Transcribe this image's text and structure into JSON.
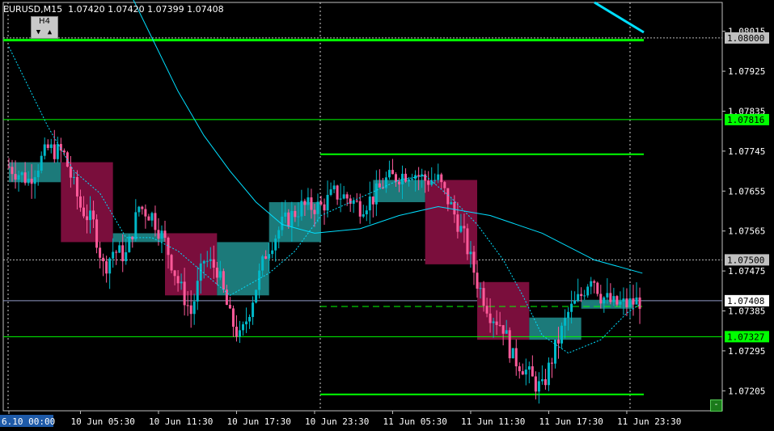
{
  "header": {
    "title": "EURUSD,M15  1.07420 1.07420 1.07399 1.07408",
    "timeframe_badge": "H4",
    "tf_down": "▼",
    "tf_up": "▲"
  },
  "corner_button": "-",
  "chart_data": {
    "type": "candlestick",
    "symbol": "EURUSD",
    "timeframe": "M15",
    "ohlc_header": [
      1.0742,
      1.0742,
      1.07399,
      1.07408
    ],
    "ylim": [
      1.0716,
      1.0808
    ],
    "price_ticks": [
      "1.08015",
      "1.07925",
      "1.07835",
      "1.07745",
      "1.07655",
      "1.07565",
      "1.07475",
      "1.07385",
      "1.07295",
      "1.07205"
    ],
    "price_tick_values": [
      1.08015,
      1.07925,
      1.07835,
      1.07745,
      1.07655,
      1.07565,
      1.07475,
      1.07385,
      1.07295,
      1.07205
    ],
    "time_ticks": [
      "6.10 00:00",
      "10 Jun 05:30",
      "10 Jun 11:30",
      "10 Jun 17:30",
      "10 Jun 23:30",
      "11 Jun 05:30",
      "11 Jun 11:30",
      "11 Jun 17:30",
      "11 Jun 23:30"
    ],
    "price_labels": [
      {
        "text": "1.08000",
        "value": 1.08,
        "style": "gray"
      },
      {
        "text": "1.07816",
        "value": 1.07816,
        "style": "green"
      },
      {
        "text": "1.07500",
        "value": 1.075,
        "style": "gray"
      },
      {
        "text": "1.07408",
        "value": 1.07408,
        "style": "white"
      },
      {
        "text": "1.07327",
        "value": 1.07327,
        "style": "green"
      }
    ],
    "h4_boxes": [
      {
        "t0": "10 Jun 00:00",
        "t1": "10 Jun 04:00",
        "open": 1.0772,
        "close": 1.07675,
        "direction": "up"
      },
      {
        "t0": "10 Jun 04:00",
        "t1": "10 Jun 08:00",
        "open": 1.0772,
        "close": 1.0754,
        "direction": "down"
      },
      {
        "t0": "10 Jun 08:00",
        "t1": "10 Jun 12:00",
        "open": 1.0754,
        "close": 1.0756,
        "direction": "up"
      },
      {
        "t0": "10 Jun 12:00",
        "t1": "10 Jun 16:00",
        "open": 1.0756,
        "close": 1.0742,
        "direction": "down"
      },
      {
        "t0": "10 Jun 16:00",
        "t1": "10 Jun 20:00",
        "open": 1.0742,
        "close": 1.0754,
        "direction": "up"
      },
      {
        "t0": "10 Jun 20:00",
        "t1": "11 Jun 00:00",
        "open": 1.0754,
        "close": 1.0763,
        "direction": "up"
      },
      {
        "t0": "11 Jun 04:00",
        "t1": "11 Jun 08:00",
        "open": 1.0763,
        "close": 1.0768,
        "direction": "up"
      },
      {
        "t0": "11 Jun 08:00",
        "t1": "11 Jun 12:00",
        "open": 1.0768,
        "close": 1.0749,
        "direction": "down"
      },
      {
        "t0": "11 Jun 12:00",
        "t1": "11 Jun 16:00",
        "open": 1.0745,
        "close": 1.0732,
        "direction": "down"
      },
      {
        "t0": "11 Jun 16:00",
        "t1": "11 Jun 20:00",
        "open": 1.0732,
        "close": 1.0737,
        "direction": "up"
      },
      {
        "t0": "11 Jun 20:00",
        "t1": "12 Jun 00:00",
        "open": 1.0739,
        "close": 1.0741,
        "direction": "up"
      }
    ],
    "levels": [
      {
        "value": 1.07995,
        "color": "#00ff00",
        "kind": "thick-line"
      },
      {
        "value": 1.07816,
        "color": "#00ff00",
        "kind": "thin-line"
      },
      {
        "value": 1.07738,
        "color": "#00ff00",
        "kind": "segment",
        "from": "10 Jun 23:30"
      },
      {
        "value": 1.07395,
        "color": "#00ff00",
        "kind": "dashed-segment",
        "from": "10 Jun 23:30"
      },
      {
        "value": 1.07327,
        "color": "#00ff00",
        "kind": "thin-line"
      },
      {
        "value": 1.07197,
        "color": "#00ff00",
        "kind": "segment",
        "from": "10 Jun 23:30"
      }
    ]
  },
  "colors": {
    "background": "#000000",
    "bull": "#00b8c8",
    "bear": "#ff5a9a",
    "bull_box": "#1c7a7a",
    "bear_box": "#7a0e3c",
    "level": "#00ff00",
    "ma": "#00dfff"
  }
}
